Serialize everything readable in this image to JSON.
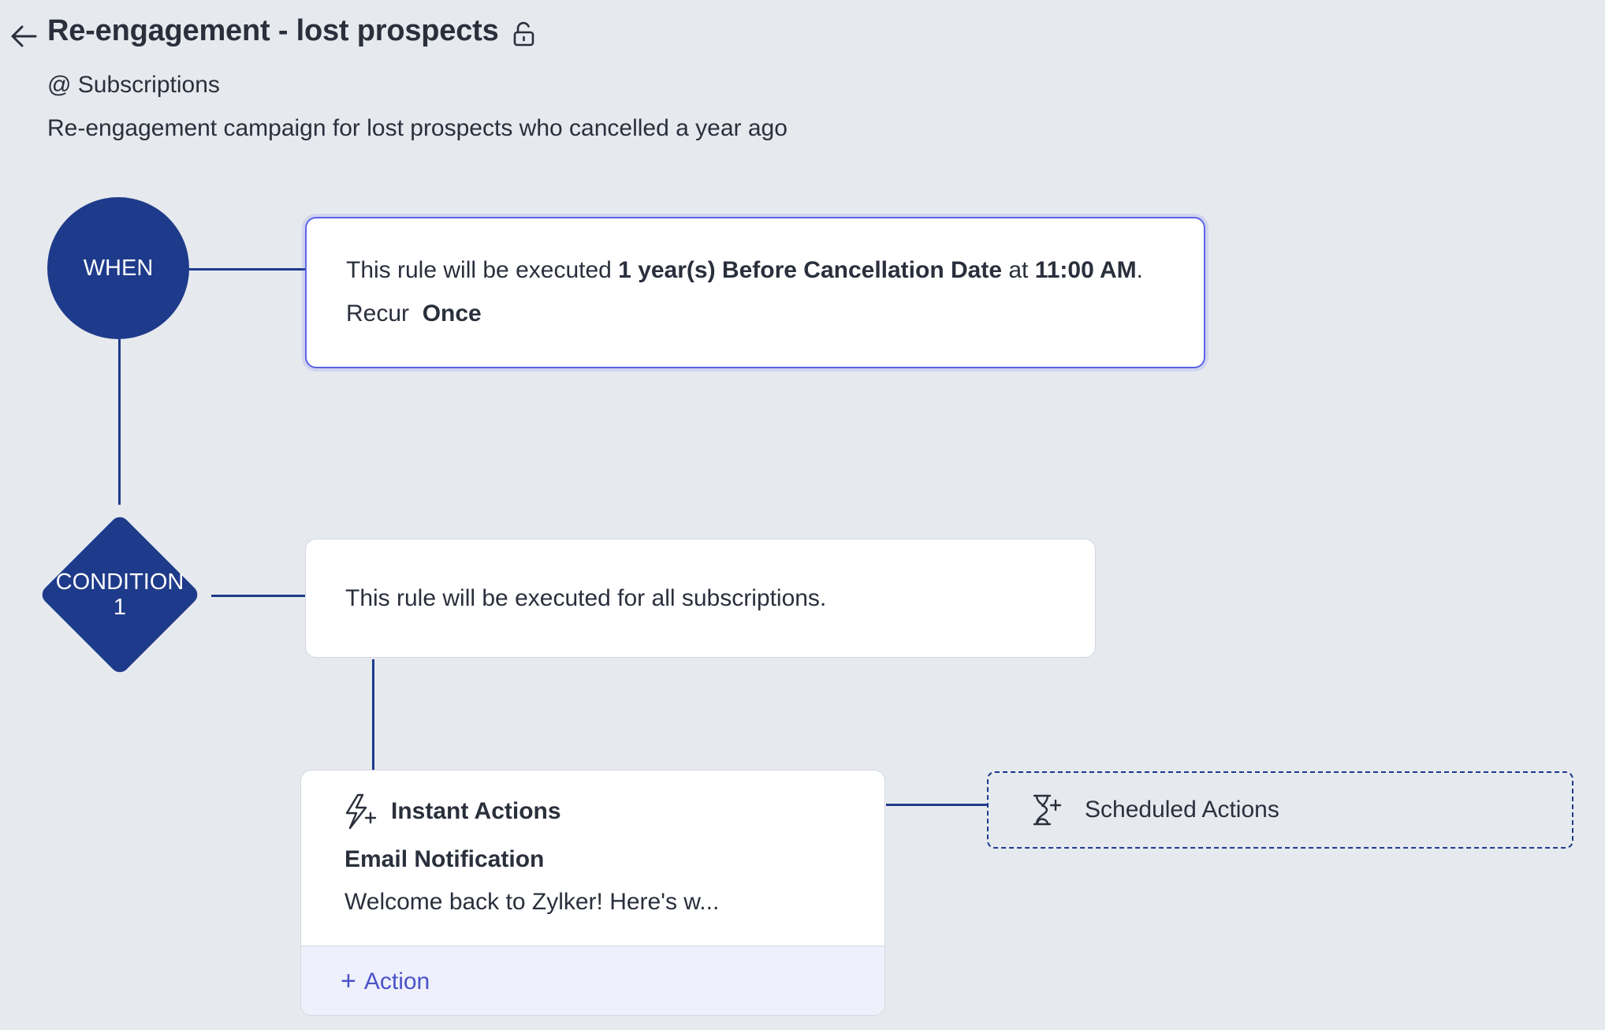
{
  "header": {
    "title": "Re-engagement - lost prospects",
    "module": "@ Subscriptions",
    "description": "Re-engagement campaign for lost prospects who cancelled a year ago",
    "icons": {
      "back": "arrow-left-icon",
      "lock": "unlock-icon"
    }
  },
  "when": {
    "label": "WHEN",
    "rule_prefix": "This rule will be executed ",
    "rule_timing": "1 year(s) Before Cancellation Date",
    "rule_at": " at ",
    "rule_time": "11:00 AM",
    "rule_end": ".",
    "recur_label": "Recur",
    "recur_value": "Once"
  },
  "condition": {
    "label_line1": "CONDITION",
    "label_line2": "1",
    "text": "This rule will be executed for all subscriptions."
  },
  "instant_actions": {
    "title": "Instant Actions",
    "icon": "lightning-plus-icon",
    "action_type": "Email Notification",
    "action_summary": "Welcome back to Zylker! Here's w...",
    "add_label": "Action",
    "add_plus": "+"
  },
  "scheduled_actions": {
    "title": "Scheduled Actions",
    "icon": "hourglass-plus-icon"
  },
  "colors": {
    "node": "#1e3a8a",
    "background": "#e6e9ee",
    "accent": "#4b53c8",
    "focus_border": "#5b63e6"
  }
}
